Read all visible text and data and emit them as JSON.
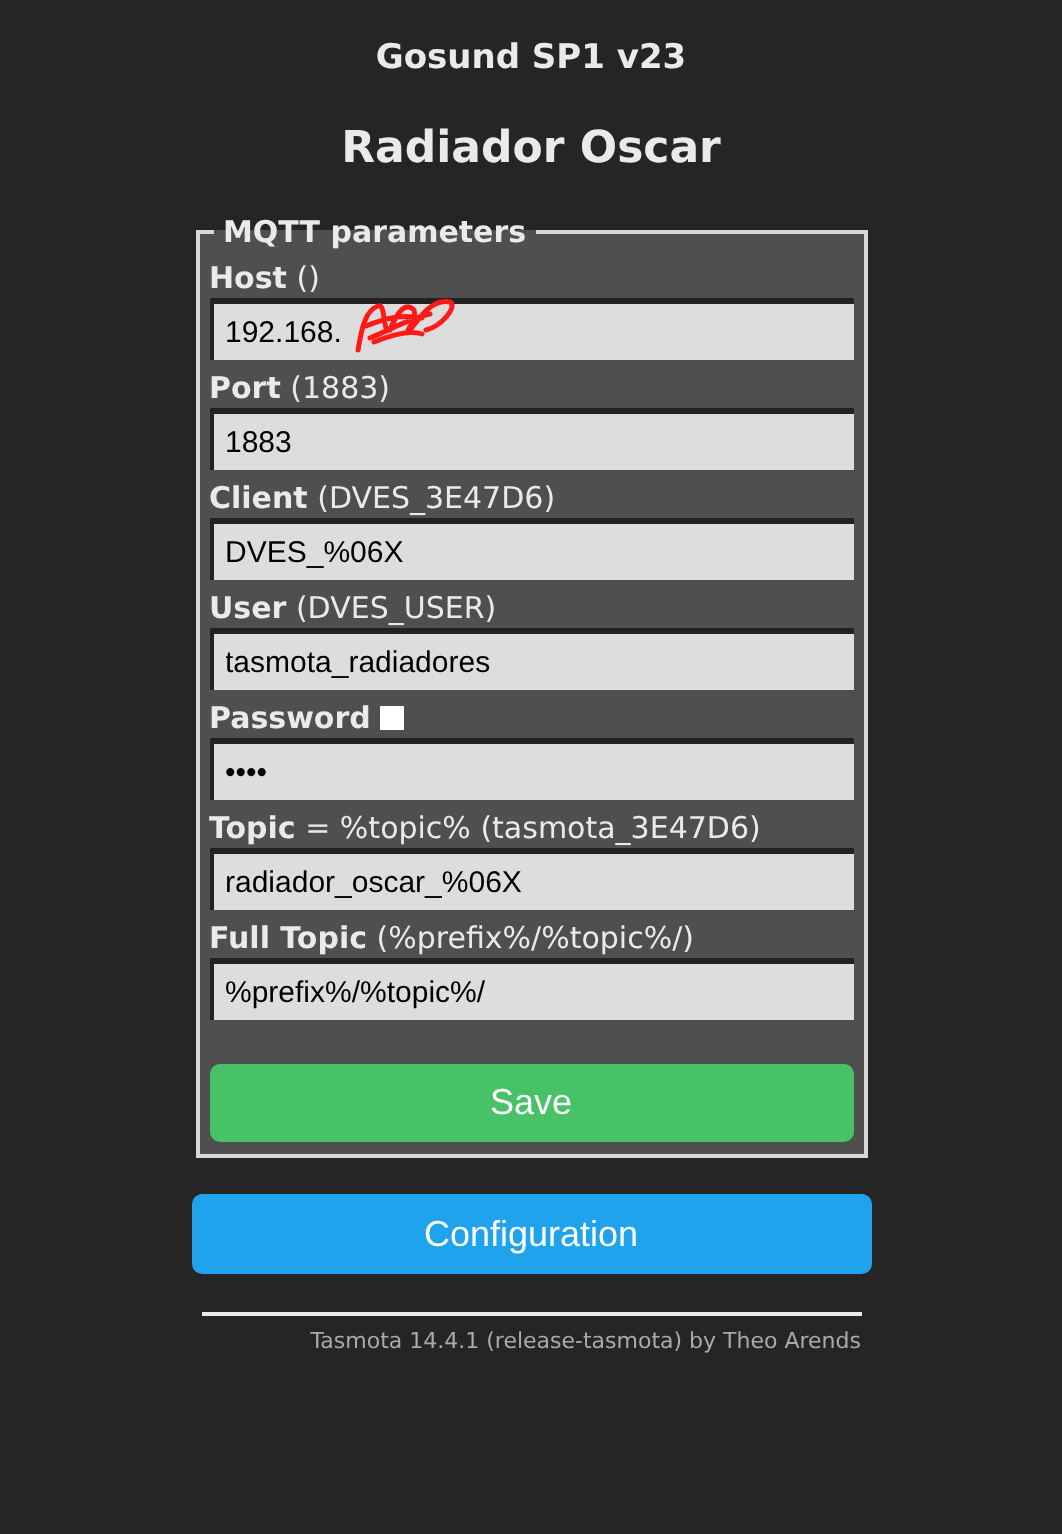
{
  "header": {
    "device": "Gosund SP1 v23",
    "name": "Radiador Oscar"
  },
  "form": {
    "legend": "MQTT parameters",
    "fields": [
      {
        "kind": "text",
        "label": "**Host** ()",
        "value": "192.168.",
        "redacted": true
      },
      {
        "kind": "text",
        "label": "**Port** (1883)",
        "value": "1883"
      },
      {
        "kind": "text",
        "label": "**Client** (DVES_3E47D6)",
        "value": "DVES_%06X"
      },
      {
        "kind": "text",
        "label": "**User** (DVES_USER)",
        "value": "tasmota_radiadores"
      },
      {
        "kind": "password",
        "label": "**Password**",
        "checked": false,
        "value": "••••"
      },
      {
        "kind": "text",
        "label": "**Topic** = %topic% (tasmota_3E47D6)",
        "value": "radiador_oscar_%06X"
      },
      {
        "kind": "text",
        "label": "**Full Topic** (%prefix%/%topic%/)",
        "value": "%prefix%/%topic%/"
      }
    ],
    "save": "Save"
  },
  "configuration": "Configuration",
  "footer": "Tasmota 14.4.1 (release-tasmota) by Theo Arends"
}
